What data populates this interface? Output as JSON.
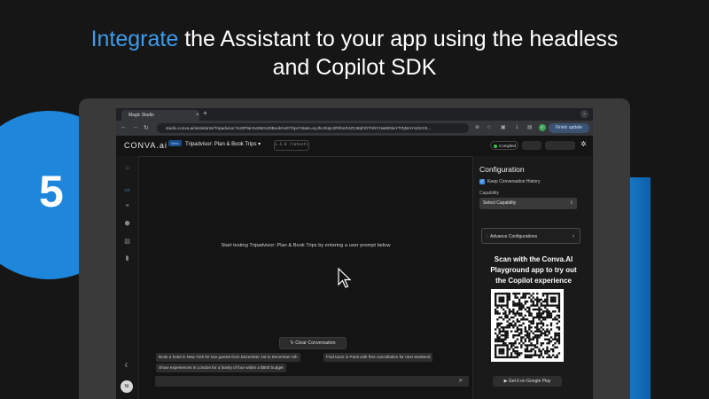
{
  "banner": {
    "headline_highlight": "Integrate",
    "headline_line1_rest": " the Assistant to your app using the headless",
    "headline_line2": "and Copilot SDK",
    "step_number": "5",
    "accent_color": "#1e87dc"
  },
  "browser": {
    "tab_title": "Magic Studio",
    "tab_close_icon": "×",
    "new_tab_icon": "+",
    "url": "studio.conva.ai/assistants/Tripadvisor:%20Plan%20&%20Book%20Trips?state=eyJhc3Npc3RhbnRJZCI6IjFiOTNhYzIwMDkxYTRjNmY4ZmY5...",
    "finish_update_label": "Finish update"
  },
  "app_header": {
    "logo": "CONVA.ai",
    "beta_badge": "Beta",
    "assistant_name": "Tripadvisor: Plan & Book Trips",
    "version": "v.1.0 (latest)",
    "status": "Compiled",
    "status_color": "#3ac45a"
  },
  "sidebar": {
    "icons": [
      "home-icon",
      "chat-icon",
      "list-icon",
      "cube-icon",
      "image-icon",
      "analytics-icon"
    ],
    "avatar_initials": "NI"
  },
  "chat": {
    "empty_prompt": "Start testing Tripadvisor: Plan & Book Trips by entering a user prompt below",
    "clear_button": "Clear Conversation",
    "suggestions": [
      "Book a hotel in New York for two guests from December 1st to December 5th",
      "Find tours in Paris with free cancellation for next weekend",
      "Show experiences in London for a family of four within a $500 budget"
    ]
  },
  "config": {
    "title": "Configuration",
    "keep_history_label": "Keep Conversation History",
    "keep_history_checked": true,
    "capability_label": "Capability",
    "capability_select": "Select Capability",
    "advanced_button": "Advance Configurations",
    "scan_text_line1": "Scan with the Conva.AI",
    "scan_text_line2": "Playground app to try out",
    "scan_text_line3": "the Copilot experience",
    "google_play_button": "Get it on Google Play"
  }
}
